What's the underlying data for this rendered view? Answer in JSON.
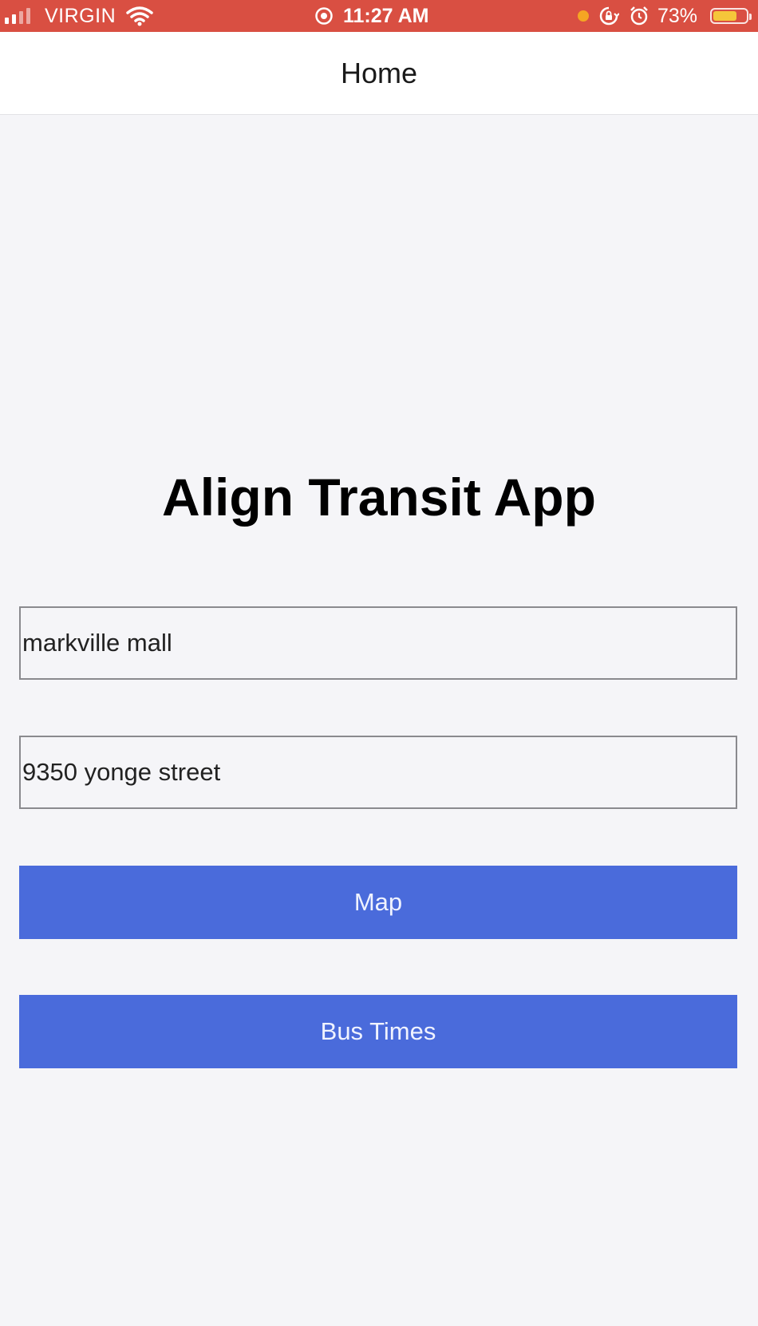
{
  "status_bar": {
    "carrier": "VIRGIN",
    "time": "11:27 AM",
    "battery_percent": "73%",
    "battery_level": 0.73,
    "icons": [
      "signal-icon",
      "wifi-icon",
      "location-icon",
      "orange-dot-indicator",
      "rotation-lock-icon",
      "alarm-icon",
      "battery-icon"
    ],
    "colors": {
      "background": "#d94f42",
      "battery_fill": "#f5c63a",
      "indicator_dot": "#f5a623"
    }
  },
  "nav": {
    "title": "Home"
  },
  "main": {
    "title": "Align Transit App",
    "origin_input": {
      "value": "markville mall"
    },
    "destination_input": {
      "value": "9350 yonge street"
    },
    "map_button": {
      "label": "Map"
    },
    "bus_times_button": {
      "label": "Bus Times"
    },
    "colors": {
      "accent": "#4a6bdb",
      "background": "#f5f5f8"
    }
  }
}
